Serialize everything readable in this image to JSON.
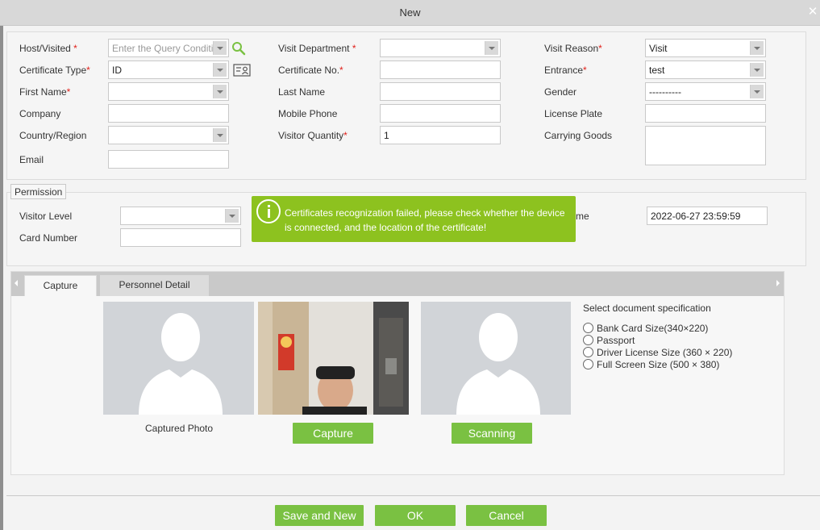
{
  "window": {
    "title": "New"
  },
  "form": {
    "host_label": "Host/Visited",
    "host_placeholder": "Enter the Query Condition",
    "visit_department_label": "Visit Department",
    "visit_department_value": "",
    "visit_reason_label": "Visit Reason",
    "visit_reason_value": "Visit",
    "certificate_type_label": "Certificate Type",
    "certificate_type_value": "ID",
    "certificate_no_label": "Certificate No.",
    "certificate_no_value": "",
    "entrance_label": "Entrance",
    "entrance_value": "test",
    "first_name_label": "First Name",
    "first_name_value": "",
    "last_name_label": "Last Name",
    "last_name_value": "",
    "gender_label": "Gender",
    "gender_value": "----------",
    "company_label": "Company",
    "company_value": "",
    "mobile_phone_label": "Mobile Phone",
    "mobile_phone_value": "",
    "license_plate_label": "License Plate",
    "license_plate_value": "",
    "country_label": "Country/Region",
    "country_value": "",
    "visitor_quantity_label": "Visitor Quantity",
    "visitor_quantity_value": "1",
    "carrying_goods_label": "Carrying Goods",
    "carrying_goods_value": "",
    "email_label": "Email",
    "email_value": "",
    "required_mark": "*"
  },
  "permission": {
    "legend": "Permission",
    "visitor_level_label": "Visitor Level",
    "visitor_level_value": "",
    "card_number_label": "Card Number",
    "card_number_value": "",
    "end_time_label_tail": "me",
    "end_time_value": "2022-06-27 23:59:59"
  },
  "toast": {
    "message": "Certificates recognization failed, please check whether the device is connected, and the location of the certificate!"
  },
  "tabs": [
    {
      "label": "Capture",
      "active": true
    },
    {
      "label": "Personnel Detail",
      "active": false
    }
  ],
  "capture": {
    "captured_photo_label": "Captured Photo",
    "capture_button": "Capture",
    "scanning_button": "Scanning",
    "doc_spec_title": "Select document specification",
    "doc_options": [
      "Bank Card Size(340×220)",
      "Passport",
      "Driver License Size (360 × 220)",
      "Full Screen Size (500 × 380)"
    ]
  },
  "footer": {
    "save_new": "Save and New",
    "ok": "OK",
    "cancel": "Cancel"
  },
  "icons": {
    "search": "search-icon",
    "id_card": "id-card-icon",
    "close": "close-icon",
    "info": "info-icon"
  },
  "colors": {
    "accent_green": "#7ac142",
    "toast_green": "#8dc21f",
    "required_red": "#e0201a"
  }
}
